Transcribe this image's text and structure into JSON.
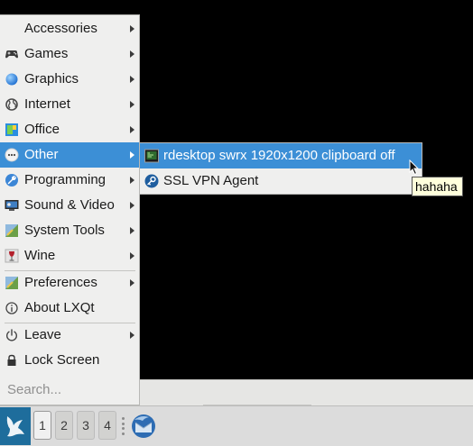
{
  "main_menu": {
    "items": [
      {
        "label": "Accessories",
        "icon": "accessories-icon",
        "has_submenu": true
      },
      {
        "label": "Games",
        "icon": "gamepad-icon",
        "has_submenu": true
      },
      {
        "label": "Graphics",
        "icon": "graphics-icon",
        "has_submenu": true
      },
      {
        "label": "Internet",
        "icon": "globe-icon",
        "has_submenu": true
      },
      {
        "label": "Office",
        "icon": "office-icon",
        "has_submenu": true
      },
      {
        "label": "Other",
        "icon": "ellipsis-icon",
        "has_submenu": true,
        "active": true
      },
      {
        "label": "Programming",
        "icon": "wrench-icon",
        "has_submenu": true
      },
      {
        "label": "Sound & Video",
        "icon": "monitor-icon",
        "has_submenu": true
      },
      {
        "label": "System Tools",
        "icon": "system-tools-icon",
        "has_submenu": true
      },
      {
        "label": "Wine",
        "icon": "wine-glass-icon",
        "has_submenu": true
      },
      {
        "label": "Preferences",
        "icon": "preferences-icon",
        "has_submenu": true
      },
      {
        "label": "About LXQt",
        "icon": "info-icon",
        "has_submenu": false
      },
      {
        "label": "Leave",
        "icon": "power-icon",
        "has_submenu": true
      },
      {
        "label": "Lock Screen",
        "icon": "lock-icon",
        "has_submenu": false
      }
    ],
    "search_placeholder": "Search..."
  },
  "submenu": {
    "items": [
      {
        "label": "rdesktop swrx 1920x1200 clipboard off",
        "icon": "terminal-screen-icon",
        "active": true
      },
      {
        "label": "SSL VPN Agent",
        "icon": "vpn-key-icon",
        "active": false
      }
    ]
  },
  "tooltip": {
    "text": "hahaha"
  },
  "panel": {
    "desktops": [
      "1",
      "2",
      "3",
      "4"
    ],
    "current_desktop": "1"
  },
  "colors": {
    "highlight": "#3c8fd6",
    "menu_bg": "#efefee",
    "desktop_bg": "#000000",
    "panel_bg": "#dcdcdc",
    "start_button_bg": "#1e6d9c",
    "tooltip_bg": "#ffffdc"
  }
}
